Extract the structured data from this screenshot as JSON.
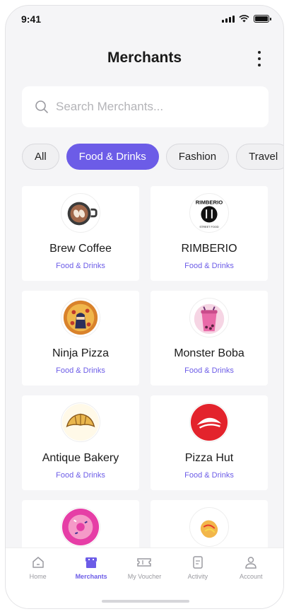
{
  "status": {
    "time": "9:41"
  },
  "header": {
    "title": "Merchants"
  },
  "search": {
    "placeholder": "Search Merchants..."
  },
  "filters": [
    {
      "label": "All",
      "active": false
    },
    {
      "label": "Food & Drinks",
      "active": true
    },
    {
      "label": "Fashion",
      "active": false
    },
    {
      "label": "Travel",
      "active": false
    }
  ],
  "merchants": [
    {
      "name": "Brew Coffee",
      "category": "Food & Drinks",
      "icon": "coffee-cup-icon"
    },
    {
      "name": "RIMBERIO",
      "category": "Food & Drinks",
      "icon": "rimberio-street-food-logo",
      "logo_text": "RIMBERIO",
      "logo_subtext": "STREET FOOD"
    },
    {
      "name": "Ninja Pizza",
      "category": "Food & Drinks",
      "icon": "ninja-pizza-icon"
    },
    {
      "name": "Monster Boba",
      "category": "Food & Drinks",
      "icon": "boba-cup-icon"
    },
    {
      "name": "Antique Bakery",
      "category": "Food & Drinks",
      "icon": "croissant-icon"
    },
    {
      "name": "Pizza Hut",
      "category": "Food & Drinks",
      "icon": "pizza-hut-roof-icon"
    },
    {
      "name": "",
      "category": "",
      "icon": "donut-icon"
    },
    {
      "name": "",
      "category": "",
      "icon": "corn-dog-icon"
    }
  ],
  "nav": [
    {
      "label": "Home",
      "icon": "home-icon",
      "active": false
    },
    {
      "label": "Merchants",
      "icon": "store-icon",
      "active": true
    },
    {
      "label": "My Voucher",
      "icon": "ticket-icon",
      "active": false
    },
    {
      "label": "Activity",
      "icon": "document-icon",
      "active": false
    },
    {
      "label": "Account",
      "icon": "user-icon",
      "active": false
    }
  ],
  "colors": {
    "accent": "#6c5ce7",
    "background": "#f5f5f7"
  }
}
